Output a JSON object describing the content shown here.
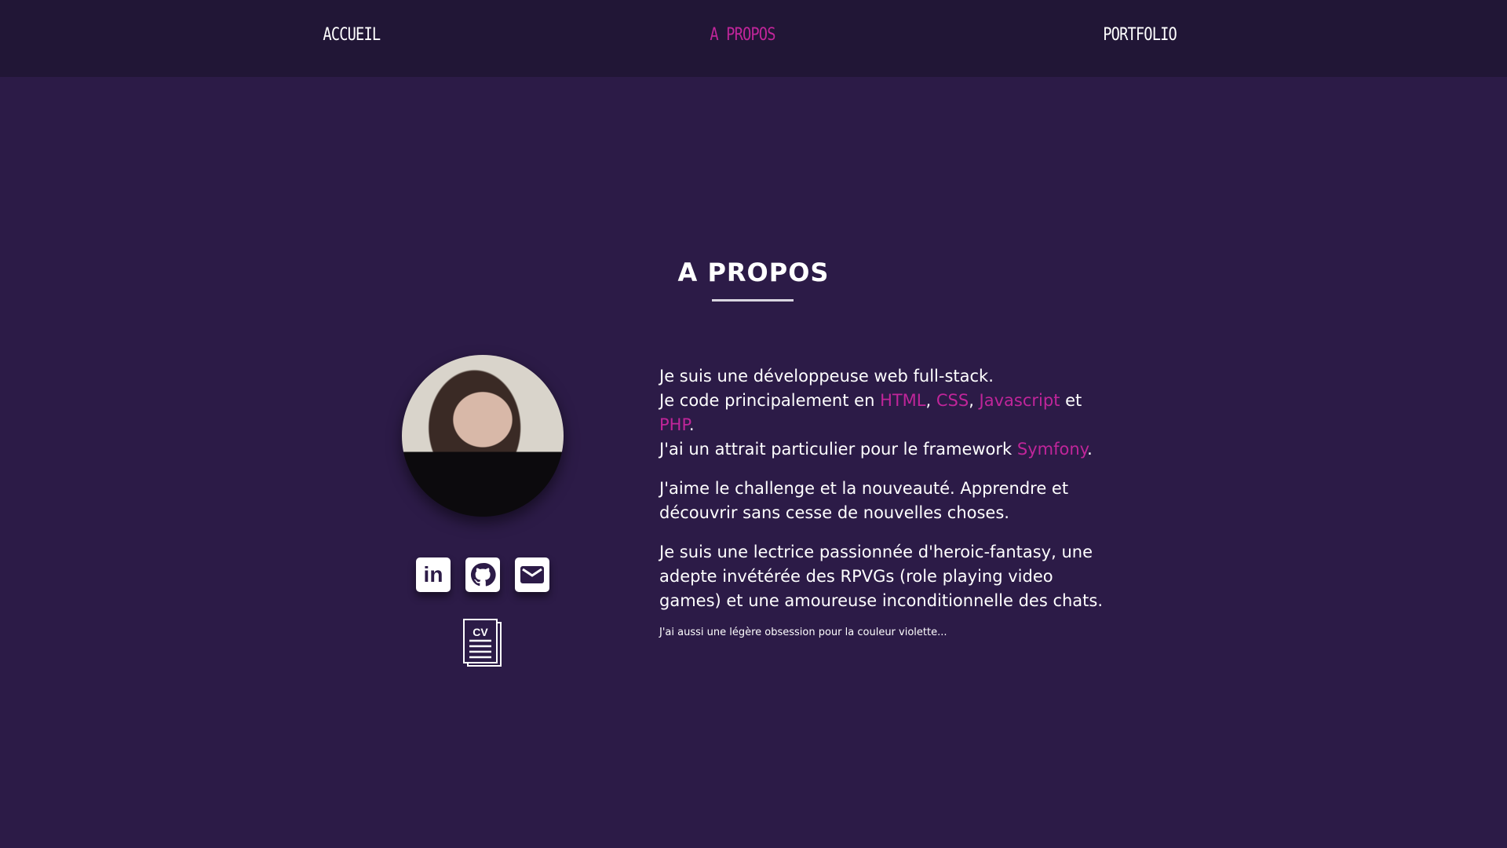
{
  "nav": {
    "items": [
      {
        "label": "ACCUEIL",
        "active": false
      },
      {
        "label": "A PROPOS",
        "active": true
      },
      {
        "label": "PORTFOLIO",
        "active": false
      }
    ]
  },
  "section": {
    "title": "A PROPOS"
  },
  "profile": {
    "social": [
      {
        "icon": "linkedin-icon",
        "glyph": "in"
      },
      {
        "icon": "github-icon"
      },
      {
        "icon": "mail-icon"
      }
    ],
    "cv_label": "CV"
  },
  "about": {
    "p1": {
      "s1": "Je suis une développeuse web full-stack.",
      "s2": "Je code principalement en ",
      "html": "HTML",
      "sep1": ", ",
      "css": "CSS",
      "sep2": ", ",
      "js": "Javascript",
      "and": " et ",
      "php": "PHP",
      "dot": ".",
      "s3": "J'ai un attrait particulier pour le framework ",
      "symfony": "Symfony",
      "dot2": "."
    },
    "p2": "J'aime le challenge et la nouveauté. Apprendre et découvrir sans cesse de nouvelles choses.",
    "p3": "Je suis une lectrice passionnée d'heroic-fantasy, une adepte invétérée des RPVGs (role playing video games) et une amoureuse inconditionnelle des chats.",
    "p4": "J'ai aussi une légère obsession pour la couleur violette..."
  },
  "colors": {
    "background": "#2c1b47",
    "nav": "#211636",
    "accent": "#c0259a"
  }
}
